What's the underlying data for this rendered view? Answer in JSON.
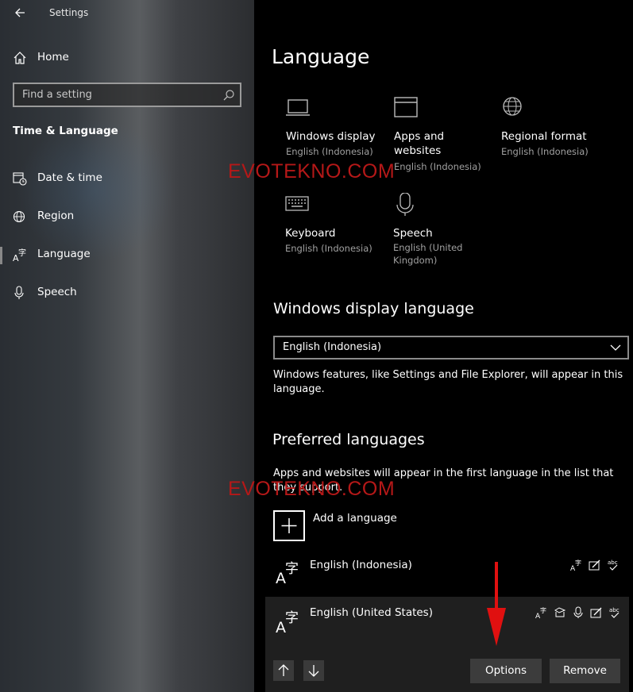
{
  "window": {
    "title": "Settings",
    "back_icon": "back-arrow-icon"
  },
  "sidebar": {
    "home_label": "Home",
    "search_placeholder": "Find a setting",
    "section_title": "Time & Language",
    "items": [
      {
        "label": "Date & time",
        "icon": "calendar-clock-icon"
      },
      {
        "label": "Region",
        "icon": "globe-icon"
      },
      {
        "label": "Language",
        "icon": "language-icon",
        "selected": true
      },
      {
        "label": "Speech",
        "icon": "microphone-icon"
      }
    ]
  },
  "main": {
    "title": "Language",
    "tiles": [
      {
        "name": "Windows display",
        "sub": "English (Indonesia)",
        "icon": "monitor-icon"
      },
      {
        "name": "Apps and websites",
        "sub": "English (Indonesia)",
        "icon": "window-icon"
      },
      {
        "name": "Regional format",
        "sub": "English (Indonesia)",
        "icon": "globe-icon"
      },
      {
        "name": "Keyboard",
        "sub": "English (Indonesia)",
        "icon": "keyboard-icon"
      },
      {
        "name": "Speech",
        "sub": "English (United Kingdom)",
        "icon": "microphone-icon"
      }
    ],
    "watermark": "EVOTEKNO.COM",
    "display_language": {
      "heading": "Windows display language",
      "selected": "English (Indonesia)",
      "description": "Windows features, like Settings and File Explorer, will appear in this language."
    },
    "preferred": {
      "heading": "Preferred languages",
      "description": "Apps and websites will appear in the first language in the list that they support.",
      "add_label": "Add a language",
      "languages": [
        {
          "name": "English (Indonesia)",
          "features": [
            "display-language-icon",
            "handwriting-icon",
            "spellcheck-icon"
          ]
        },
        {
          "name": "English (United States)",
          "features": [
            "display-language-icon",
            "speech-icon",
            "microphone-icon",
            "handwriting-icon",
            "spellcheck-icon"
          ]
        }
      ],
      "options_label": "Options",
      "remove_label": "Remove"
    }
  },
  "colors": {
    "watermark": "#b51818",
    "annotation_arrow": "#e01010",
    "button_bg": "#3c3c3c"
  }
}
